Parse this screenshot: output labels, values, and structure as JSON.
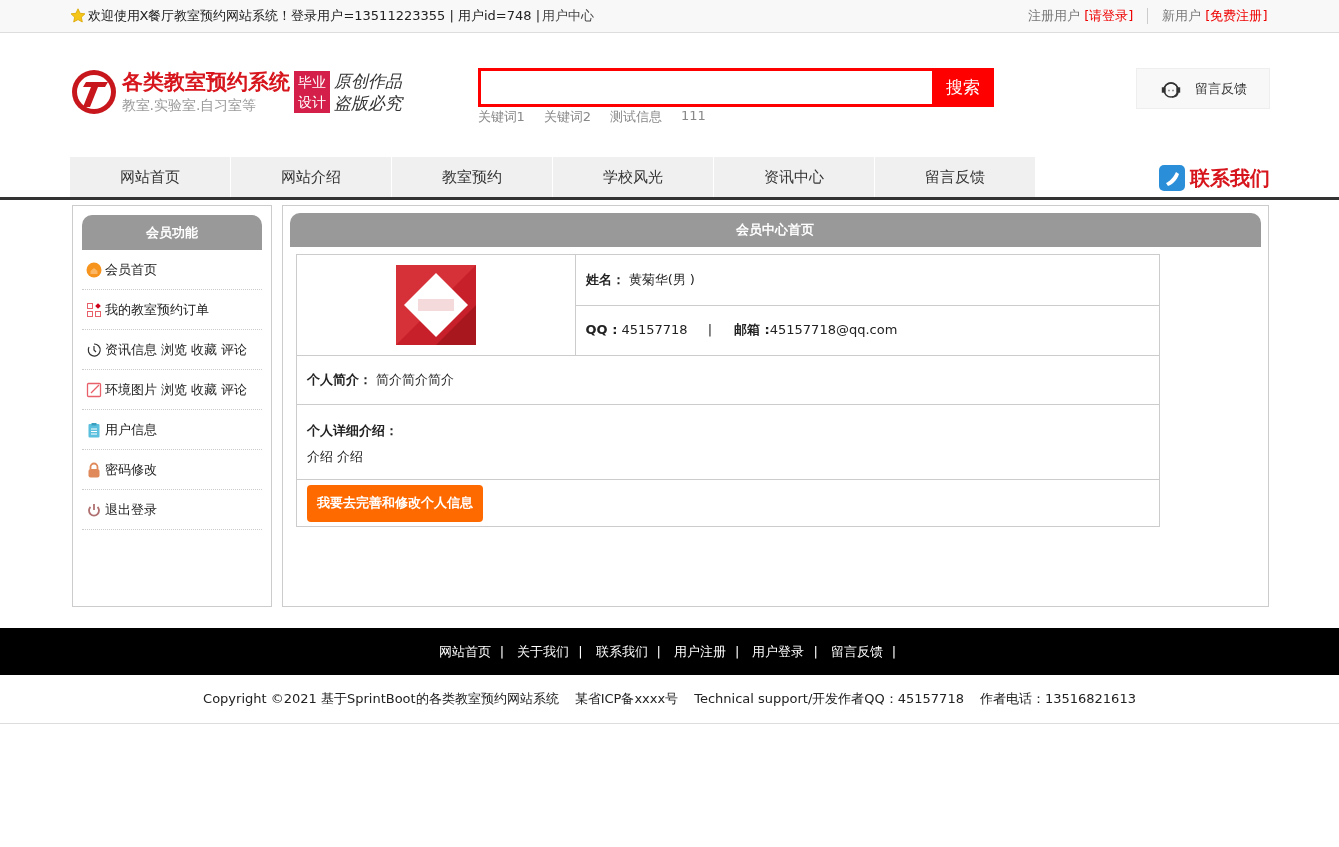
{
  "top_bar": {
    "welcome": "欢迎使用X餐厅教室预约网站系统！登录用户=13511223355 | 用户id=748 |",
    "user_center_link": "用户中心",
    "login_prompt": {
      "label": "注册用户",
      "link": "[请登录]"
    },
    "register_prompt": {
      "label": "新用户",
      "link": "[免费注册]"
    }
  },
  "header": {
    "logo": {
      "title": "各类教室预约系统",
      "subtitle": "教室.实验室.自习室等",
      "badge_lines": [
        "毕业",
        "设计"
      ],
      "slogan_lines": [
        "原创作品",
        "盗版必究"
      ]
    },
    "search": {
      "button": "搜索"
    },
    "keywords": [
      "关键词1",
      "关键词2",
      "测试信息",
      "111"
    ],
    "feedback_button": "留言反馈"
  },
  "nav": {
    "items": [
      "网站首页",
      "网站介绍",
      "教室预约",
      "学校风光",
      "资讯中心",
      "留言反馈"
    ],
    "contact": "联系我们"
  },
  "sidebar": {
    "title": "会员功能",
    "items": [
      "会员首页",
      "我的教室预约订单",
      "资讯信息 浏览 收藏 评论",
      "环境图片 浏览 收藏 评论",
      "用户信息",
      "密码修改",
      "退出登录"
    ]
  },
  "member": {
    "title": "会员中心首页",
    "name_label": "姓名：",
    "name": "黄菊华(男 )",
    "qq_label": "QQ :",
    "qq": "45157718",
    "separator": "|",
    "email_label": "邮箱 :",
    "email": "45157718@qq.com",
    "intro_label": "个人简介：",
    "intro": "简介简介简介",
    "detail_label": "个人详细介绍：",
    "detail": "介绍  介绍",
    "edit_button": "我要去完善和修改个人信息"
  },
  "footer": {
    "links": [
      {
        "label": "网站首页",
        "separator": "|"
      },
      {
        "label": "关于我们",
        "separator": "|"
      },
      {
        "label": "联系我们",
        "separator": "|"
      },
      {
        "label": "用户注册",
        "separator": "|"
      },
      {
        "label": "用户登录",
        "separator": "|"
      },
      {
        "label": "留言反馈",
        "separator": "|"
      }
    ],
    "copyright": [
      "Copyright ©2021 基于SprintBoot的各类教室预约网站系统",
      "某省ICP备xxxx号",
      "Technical support/开发作者QQ：45157718",
      "作者电话：13516821613"
    ]
  }
}
